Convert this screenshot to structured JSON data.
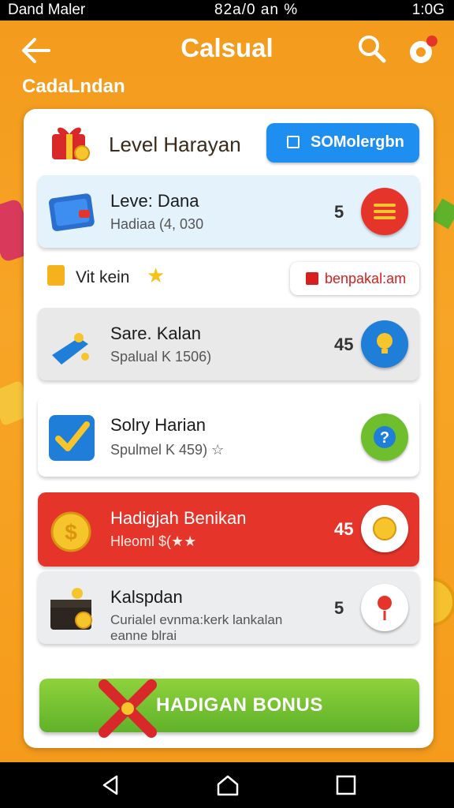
{
  "status_bar": {
    "carrier": "Dand Maler",
    "center": "82a/0 an %",
    "time": "1:0G"
  },
  "header": {
    "title": "Calsual",
    "back_icon": "back-arrow-icon",
    "search_icon": "search-icon",
    "settings_icon": "settings-icon"
  },
  "subtitle": "CadaLndan",
  "card": {
    "header": {
      "icon": "gift-box-icon",
      "title": "Level Harayan",
      "button_label": "SOMolergbn"
    },
    "section": {
      "label": "Vit kein",
      "button_label": "benpakal:am"
    },
    "rows": [
      {
        "name": "Leve: Dana",
        "sub": "Hadiaa (4, 030",
        "num": "5",
        "icon": "wallet-icon",
        "action_icon": "menu-lines-icon",
        "bg": "#e3f2fb"
      },
      {
        "name": "Sare. Kalan",
        "sub": "Spalual K 1506)",
        "num": "45",
        "icon": "shoe-icon",
        "action_icon": "lightbulb-icon",
        "bg": "#e9e9ea"
      },
      {
        "name": "Solry Harian",
        "sub": "Spulmel K 459) ☆",
        "num": "",
        "icon": "checkmark-icon",
        "action_icon": "help-icon",
        "bg": "#ffffff"
      },
      {
        "name": "Hadigjah Benikan",
        "sub": "Hleoml $(★★",
        "num": "45",
        "icon": "coin-bag-icon",
        "action_icon": "coin-icon",
        "bg": "#e5352b"
      },
      {
        "name": "Kalspdan",
        "sub": "Curialel evnma:kerk lankalan",
        "sub2": "eanne blrai",
        "num": "5",
        "icon": "treasure-box-icon",
        "action_icon": "map-pin-icon",
        "bg": "#ecedee"
      }
    ],
    "bonus_label": "HADIGAN BONUS"
  },
  "colors": {
    "accent": "#f59a1a",
    "primary_blue": "#1f8ef1",
    "danger_red": "#e5352b",
    "bonus_green": "#6fbe2e"
  }
}
